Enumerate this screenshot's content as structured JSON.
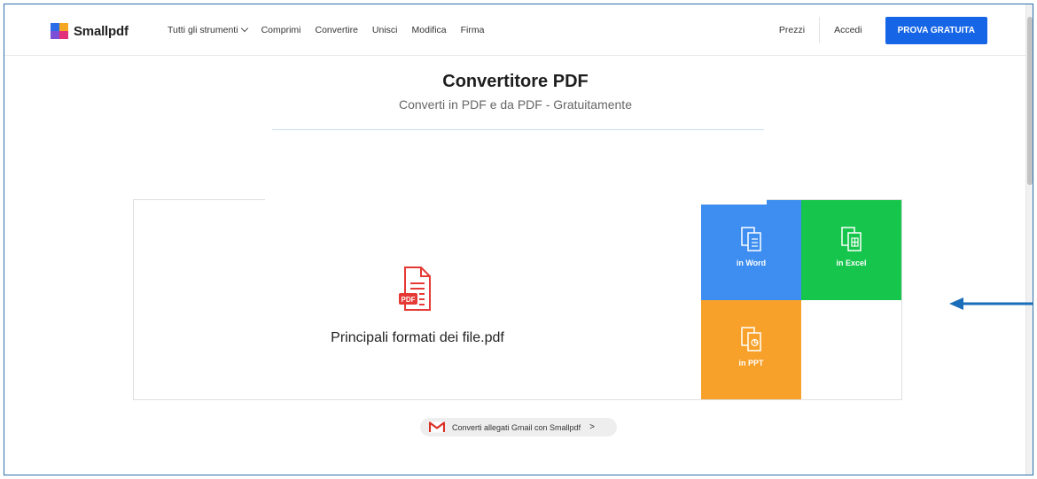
{
  "header": {
    "logo_text": "Smallpdf",
    "nav": [
      "Tutti gli strumenti",
      "Comprimi",
      "Convertire",
      "Unisci",
      "Modifica",
      "Firma"
    ],
    "prices": "Prezzi",
    "login": "Accedi",
    "cta": "PROVA GRATUITA"
  },
  "hero": {
    "title": "Convertitore PDF",
    "subtitle": "Converti in PDF e da PDF - Gratuitamente"
  },
  "file": {
    "name": "Principali formati dei file.pdf",
    "badge": "PDF"
  },
  "tiles": {
    "word": "in Word",
    "excel": "in Excel",
    "ppt": "in PPT"
  },
  "gmail": {
    "label": "Converti allegati Gmail con Smallpdf",
    "arrow": ">"
  },
  "colors": {
    "word": "#3d8ef0",
    "excel": "#16c64c",
    "ppt": "#f7a12a",
    "cta": "#1565e6",
    "pdf_red": "#e53935",
    "annotation": "#1a6db8"
  }
}
